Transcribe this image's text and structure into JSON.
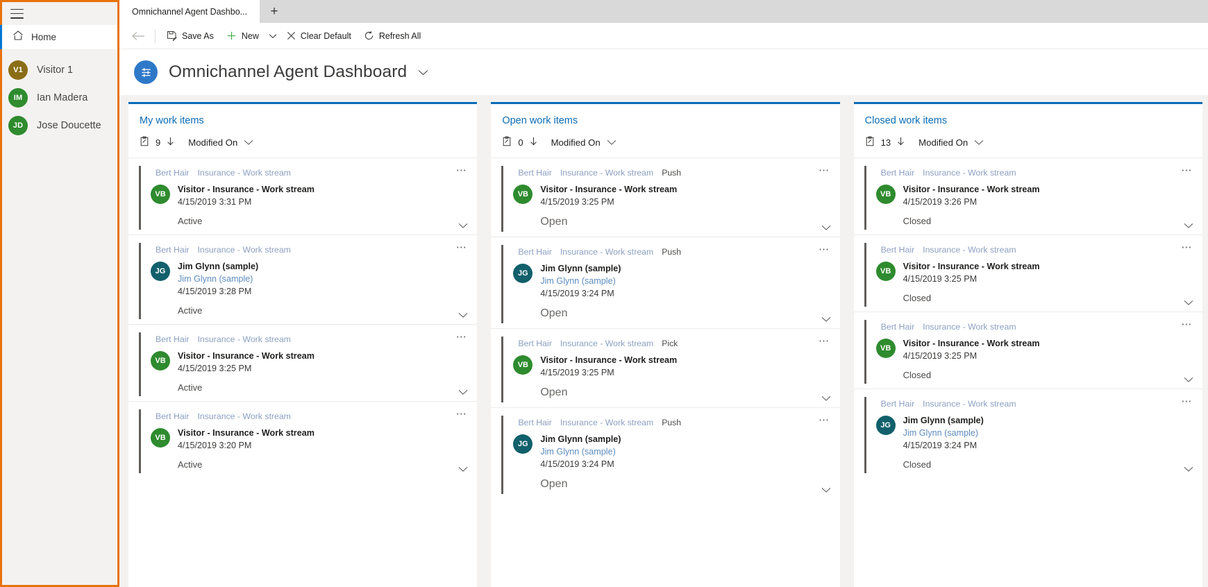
{
  "theme": {
    "accent_blue": "#0b6cb7",
    "link_blue": "#5d8cc0",
    "highlight_orange": "#e8730c",
    "board_bg": "#f3f2f1"
  },
  "sidebar": {
    "hamburger_label": "Site Map",
    "home": {
      "label": "Home",
      "icon": "home-icon"
    },
    "people": [
      {
        "initials": "V1",
        "name": "Visitor 1",
        "color": "#8a6d16"
      },
      {
        "initials": "IM",
        "name": "Ian Madera",
        "color": "#2e8b2e"
      },
      {
        "initials": "JD",
        "name": "Jose Doucette",
        "color": "#2e8b2e"
      }
    ]
  },
  "tabstrip": {
    "tabs": [
      {
        "label": "Omnichannel Agent Dashbo..."
      }
    ],
    "add_label": "+"
  },
  "commandbar": {
    "back_label": "Back",
    "items": [
      {
        "label": "Save As",
        "icon": "save-as-icon",
        "caret": false
      },
      {
        "label": "New",
        "icon": "new-plus-icon",
        "caret": true
      },
      {
        "label": "Clear Default",
        "icon": "clear-default-x-icon",
        "caret": false
      },
      {
        "label": "Refresh All",
        "icon": "refresh-icon",
        "caret": false
      }
    ]
  },
  "page": {
    "icon": "dashboard-icon",
    "title": "Omnichannel Agent Dashboard",
    "caret": "chevron-down"
  },
  "columns": [
    {
      "title": "My work items",
      "count": "9",
      "sort_label": "Modified On",
      "cards": [
        {
          "owner": "Bert Hair",
          "stream": "Insurance - Work stream",
          "mode": "",
          "initials": "VB",
          "avatar_color": "#2e8b2e",
          "title": "Visitor - Insurance - Work stream",
          "sub": "",
          "time": "4/15/2019 3:31 PM",
          "status": "Active",
          "status_big": false
        },
        {
          "owner": "Bert Hair",
          "stream": "Insurance - Work stream",
          "mode": "",
          "initials": "JG",
          "avatar_color": "#11606b",
          "title": "Jim Glynn (sample)",
          "sub": "Jim Glynn (sample)",
          "time": "4/15/2019 3:28 PM",
          "status": "Active",
          "status_big": false
        },
        {
          "owner": "Bert Hair",
          "stream": "Insurance - Work stream",
          "mode": "",
          "initials": "VB",
          "avatar_color": "#2e8b2e",
          "title": "Visitor - Insurance - Work stream",
          "sub": "",
          "time": "4/15/2019 3:25 PM",
          "status": "Active",
          "status_big": false
        },
        {
          "owner": "Bert Hair",
          "stream": "Insurance - Work stream",
          "mode": "",
          "initials": "VB",
          "avatar_color": "#2e8b2e",
          "title": "Visitor - Insurance - Work stream",
          "sub": "",
          "time": "4/15/2019 3:20 PM",
          "status": "Active",
          "status_big": false
        }
      ]
    },
    {
      "title": "Open work items",
      "count": "0",
      "sort_label": "Modified On",
      "cards": [
        {
          "owner": "Bert Hair",
          "stream": "Insurance - Work stream",
          "mode": "Push",
          "initials": "VB",
          "avatar_color": "#2e8b2e",
          "title": "Visitor - Insurance - Work stream",
          "sub": "",
          "time": "4/15/2019 3:25 PM",
          "status": "Open",
          "status_big": true
        },
        {
          "owner": "Bert Hair",
          "stream": "Insurance - Work stream",
          "mode": "Push",
          "initials": "JG",
          "avatar_color": "#11606b",
          "title": "Jim Glynn (sample)",
          "sub": "Jim Glynn (sample)",
          "time": "4/15/2019 3:24 PM",
          "status": "Open",
          "status_big": true
        },
        {
          "owner": "Bert Hair",
          "stream": "Insurance - Work stream",
          "mode": "Pick",
          "initials": "VB",
          "avatar_color": "#2e8b2e",
          "title": "Visitor - Insurance - Work stream",
          "sub": "",
          "time": "4/15/2019 3:25 PM",
          "status": "Open",
          "status_big": true
        },
        {
          "owner": "Bert Hair",
          "stream": "Insurance - Work stream",
          "mode": "Push",
          "initials": "JG",
          "avatar_color": "#11606b",
          "title": "Jim Glynn (sample)",
          "sub": "Jim Glynn (sample)",
          "time": "4/15/2019 3:24 PM",
          "status": "Open",
          "status_big": true
        }
      ]
    },
    {
      "title": "Closed work items",
      "count": "13",
      "sort_label": "Modified On",
      "cards": [
        {
          "owner": "Bert Hair",
          "stream": "Insurance - Work stream",
          "mode": "",
          "initials": "VB",
          "avatar_color": "#2e8b2e",
          "title": "Visitor - Insurance - Work stream",
          "sub": "",
          "time": "4/15/2019 3:26 PM",
          "status": "Closed",
          "status_big": false
        },
        {
          "owner": "Bert Hair",
          "stream": "Insurance - Work stream",
          "mode": "",
          "initials": "VB",
          "avatar_color": "#2e8b2e",
          "title": "Visitor - Insurance - Work stream",
          "sub": "",
          "time": "4/15/2019 3:25 PM",
          "status": "Closed",
          "status_big": false
        },
        {
          "owner": "Bert Hair",
          "stream": "Insurance - Work stream",
          "mode": "",
          "initials": "VB",
          "avatar_color": "#2e8b2e",
          "title": "Visitor - Insurance - Work stream",
          "sub": "",
          "time": "4/15/2019 3:25 PM",
          "status": "Closed",
          "status_big": false
        },
        {
          "owner": "Bert Hair",
          "stream": "Insurance - Work stream",
          "mode": "",
          "initials": "JG",
          "avatar_color": "#11606b",
          "title": "Jim Glynn (sample)",
          "sub": "Jim Glynn (sample)",
          "time": "4/15/2019 3:24 PM",
          "status": "Closed",
          "status_big": false
        }
      ]
    }
  ]
}
